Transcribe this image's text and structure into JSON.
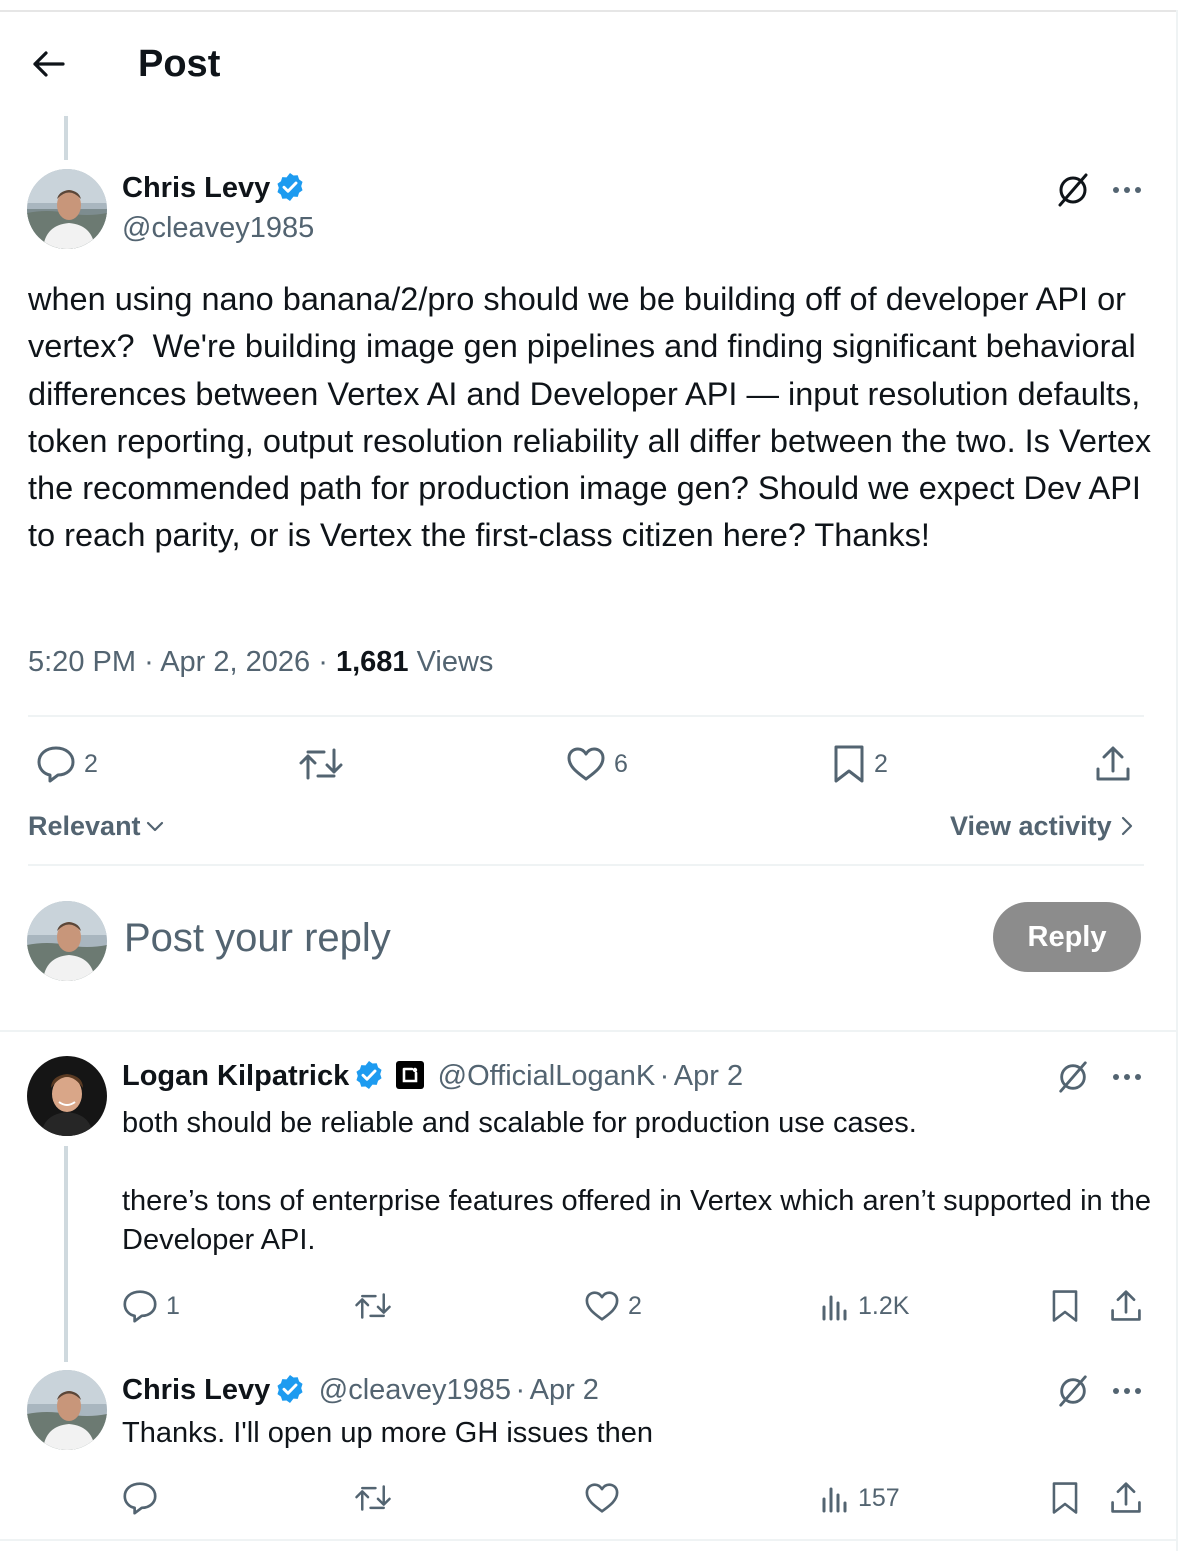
{
  "header": {
    "title": "Post"
  },
  "main_post": {
    "author_name": "Chris Levy",
    "handle": "@cleavey1985",
    "text": "when using nano banana/2/pro should we be building off of developer API or vertex?  We're building image gen pipelines and finding significant behavioral differences between Vertex AI and Developer API — input resolution defaults, token reporting, output resolution reliability all differ between the two. Is Vertex the recommended path for production image gen? Should we expect Dev API to reach parity, or is Vertex the first-class citizen here? Thanks!",
    "time": "5:20 PM",
    "date": "Apr 2, 2026",
    "views_count": "1,681",
    "views_label": "Views",
    "replies": "2",
    "likes": "6",
    "bookmarks": "2"
  },
  "sort": {
    "label": "Relevant"
  },
  "activity": {
    "label": "View activity"
  },
  "composer": {
    "placeholder": "Post your reply",
    "button_label": "Reply"
  },
  "replies": [
    {
      "author_name": "Logan Kilpatrick",
      "handle": "@OfficialLoganK",
      "date": "Apr 2",
      "text": "both should be reliable and scalable for production use cases.\n\nthere’s tons of enterprise features offered in Vertex which aren’t supported in the Developer API.",
      "replies": "1",
      "likes": "2",
      "views": "1.2K"
    },
    {
      "author_name": "Chris Levy",
      "handle": "@cleavey1985",
      "date": "Apr 2",
      "text": "Thanks. I'll open up more GH issues then",
      "views": "157"
    }
  ],
  "separator": "·",
  "colors": {
    "verified": "#1d9bf0",
    "muted": "#536471",
    "reply_button": "#8c8c8c"
  },
  "icons": [
    "back-arrow-icon",
    "verified-badge-icon",
    "grok-icon",
    "more-icon",
    "reply-icon",
    "repost-icon",
    "like-icon",
    "bookmark-icon",
    "share-icon",
    "views-icon",
    "chevron-down-icon",
    "chevron-right-icon"
  ]
}
